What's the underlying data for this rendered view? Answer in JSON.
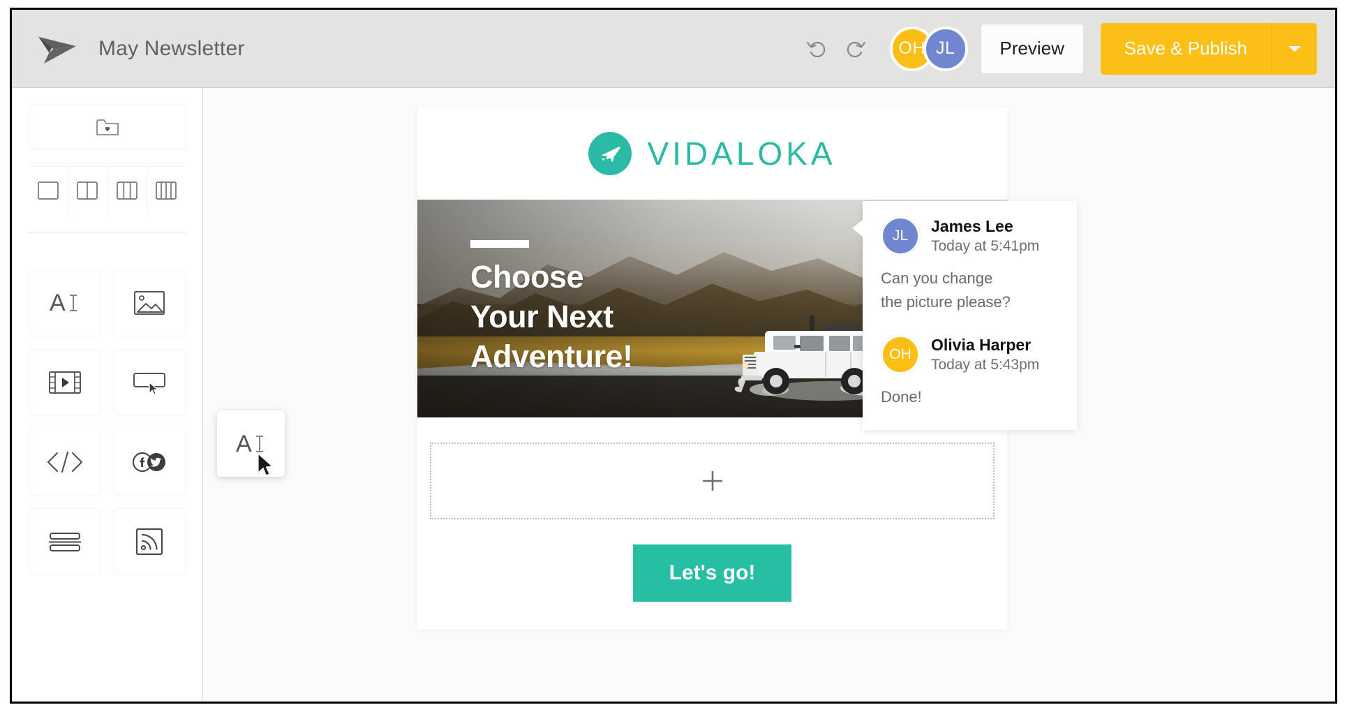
{
  "window": {
    "title": "May Newsletter"
  },
  "toolbar": {
    "logo_icon": "paper-plane-logo",
    "document_title": "May Newsletter",
    "undo_icon": "undo-icon",
    "redo_icon": "redo-icon",
    "preview_label": "Preview",
    "save_publish_label": "Save & Publish",
    "dropdown_icon": "chevron-down-icon",
    "collaborators": [
      {
        "initials": "OH",
        "color": "#fbbe16"
      },
      {
        "initials": "JL",
        "color": "#7186d0"
      }
    ]
  },
  "sidebar": {
    "saved_tile": {
      "icon": "folder-heart-icon",
      "name": "saved-blocks"
    },
    "layouts": [
      {
        "icon": "one-column-icon",
        "columns": 1
      },
      {
        "icon": "two-column-icon",
        "columns": 2
      },
      {
        "icon": "three-column-icon",
        "columns": 3
      },
      {
        "icon": "four-column-icon",
        "columns": 4
      }
    ],
    "blocks": [
      {
        "icon": "text-block-icon",
        "name": "text"
      },
      {
        "icon": "image-block-icon",
        "name": "image"
      },
      {
        "icon": "video-block-icon",
        "name": "video"
      },
      {
        "icon": "button-block-icon",
        "name": "button"
      },
      {
        "icon": "code-block-icon",
        "name": "html-code"
      },
      {
        "icon": "social-block-icon",
        "name": "social"
      },
      {
        "icon": "divider-block-icon",
        "name": "divider"
      },
      {
        "icon": "rss-block-icon",
        "name": "rss-feed"
      }
    ]
  },
  "email": {
    "logo": {
      "icon": "airplane-icon",
      "wordmark": "VIDALOKA",
      "color": "#2bbaa3"
    },
    "hero": {
      "heading": "Choose\nYour Next\nAdventure!",
      "image_alt": "white off-road vehicle driving through river with mountains"
    },
    "drop_zone": {
      "icon": "plus-icon"
    },
    "cta": {
      "label": "Let's go!",
      "color": "#26bfa3"
    }
  },
  "drag": {
    "ghost_icon": "text-block-icon",
    "cursor_icon": "mouse-pointer-icon"
  },
  "comments": {
    "items": [
      {
        "initials": "JL",
        "avatar_color": "#7186d0",
        "author": "James Lee",
        "time": "Today at 5:41pm",
        "text": "Can you change\nthe picture please?"
      },
      {
        "initials": "OH",
        "avatar_color": "#fbbe16",
        "author": "Olivia Harper",
        "time": "Today at 5:43pm",
        "text": "Done!"
      }
    ]
  }
}
